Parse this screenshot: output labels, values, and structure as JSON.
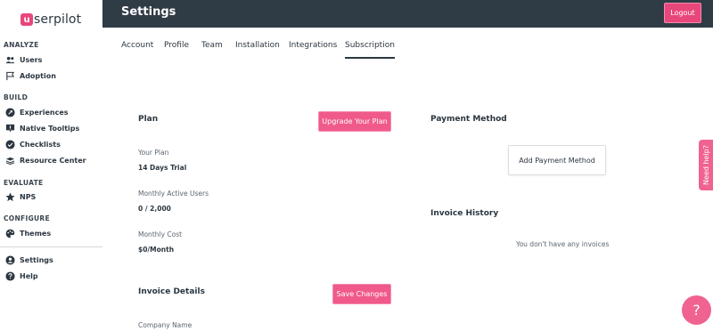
{
  "brand": {
    "logo_letter": "u",
    "logo_text": "serpilot"
  },
  "header": {
    "title": "Settings",
    "logout_label": "Logout"
  },
  "sidebar": {
    "sections": [
      {
        "label": "ANALYZE",
        "items": [
          {
            "label": "Users",
            "icon": "users-icon"
          },
          {
            "label": "Adoption",
            "icon": "flag-icon"
          }
        ]
      },
      {
        "label": "BUILD",
        "items": [
          {
            "label": "Experiences",
            "icon": "rocket-icon"
          },
          {
            "label": "Native Tooltips",
            "icon": "tooltip-icon"
          },
          {
            "label": "Checklists",
            "icon": "check-circle-icon"
          },
          {
            "label": "Resource Center",
            "icon": "book-icon"
          }
        ]
      },
      {
        "label": "EVALUATE",
        "items": [
          {
            "label": "NPS",
            "icon": "star-icon"
          }
        ]
      },
      {
        "label": "CONFIGURE",
        "items": [
          {
            "label": "Themes",
            "icon": "palette-icon"
          }
        ]
      }
    ],
    "bottom_items": [
      {
        "label": "Settings",
        "icon": "user-circle-icon"
      },
      {
        "label": "Help",
        "icon": "question-circle-icon"
      }
    ]
  },
  "tabs": [
    {
      "label": "Account",
      "active": false
    },
    {
      "label": "Profile",
      "active": false
    },
    {
      "label": "Team",
      "active": false
    },
    {
      "label": "Installation",
      "active": false
    },
    {
      "label": "Integrations",
      "active": false
    },
    {
      "label": "Subscription",
      "active": true
    }
  ],
  "plan": {
    "heading": "Plan",
    "upgrade_label": "Upgrade Your Plan",
    "your_plan_label": "Your Plan",
    "your_plan_value": "14 Days Trial",
    "mau_label": "Monthly Active Users",
    "mau_value": "0 / 2,000",
    "cost_label": "Monthly Cost",
    "cost_value": "$0/Month"
  },
  "invoice_details": {
    "heading": "Invoice Details",
    "save_label": "Save Changes",
    "company_name_label": "Company Name"
  },
  "payment": {
    "heading": "Payment Method",
    "add_label": "Add Payment Method"
  },
  "invoice_history": {
    "heading": "Invoice History",
    "empty_text": "You don't have any invoices"
  },
  "need_help_label": "Need help?",
  "help_fab_label": "?",
  "colors": {
    "accent": "#f05a8a",
    "topbar": "#2f3b45",
    "text": "#2b3640"
  }
}
